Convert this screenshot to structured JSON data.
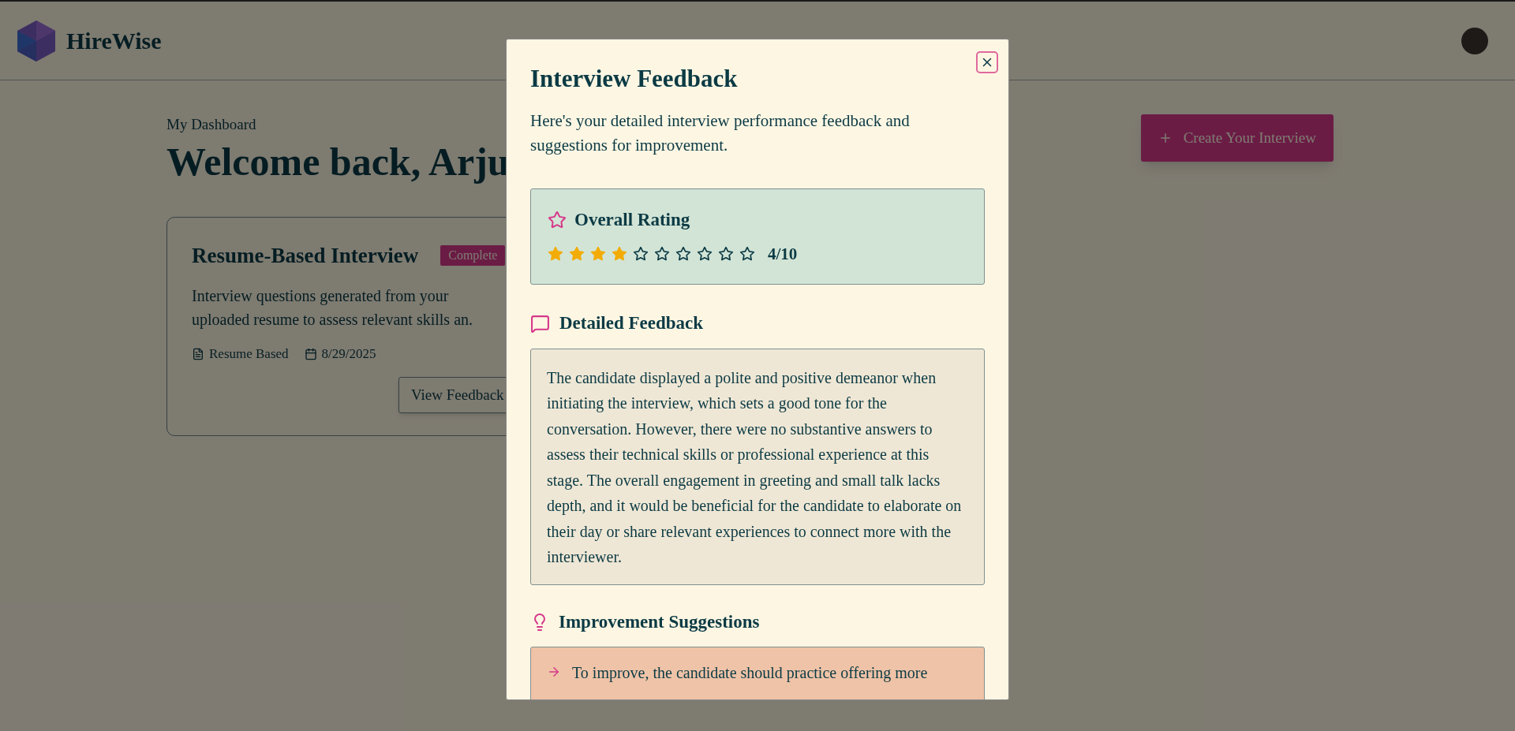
{
  "header": {
    "brand": "HireWise"
  },
  "dashboard": {
    "eyebrow": "My Dashboard",
    "heading": "Welcome back, Arju",
    "create_button": "Create Your Interview",
    "cards": [
      {
        "title": "Resume-Based Interview",
        "status": "Complete",
        "description": "Interview questions generated from your uploaded resume to assess relevant skills an.",
        "type": "Resume Based",
        "date": "8/29/2025",
        "action": "View Feedback"
      }
    ]
  },
  "modal": {
    "title": "Interview Feedback",
    "subtitle": "Here's your detailed interview performance feedback and suggestions for improvement.",
    "rating": {
      "label": "Overall Rating",
      "stars": 4,
      "score": "4/10"
    },
    "feedback": {
      "label": "Detailed Feedback",
      "text": "The candidate displayed a polite and positive demeanor when initiating the interview, which sets a good tone for the conversation. However, there were no substantive answers to assess their technical skills or professional experience at this stage. The overall engagement in greeting and small talk lacks depth, and it would be beneficial for the candidate to elaborate on their day or share relevant experiences to connect more with the interviewer."
    },
    "suggestions": {
      "label": "Improvement Suggestions",
      "items": [
        "To improve, the candidate should practice offering more"
      ]
    }
  }
}
